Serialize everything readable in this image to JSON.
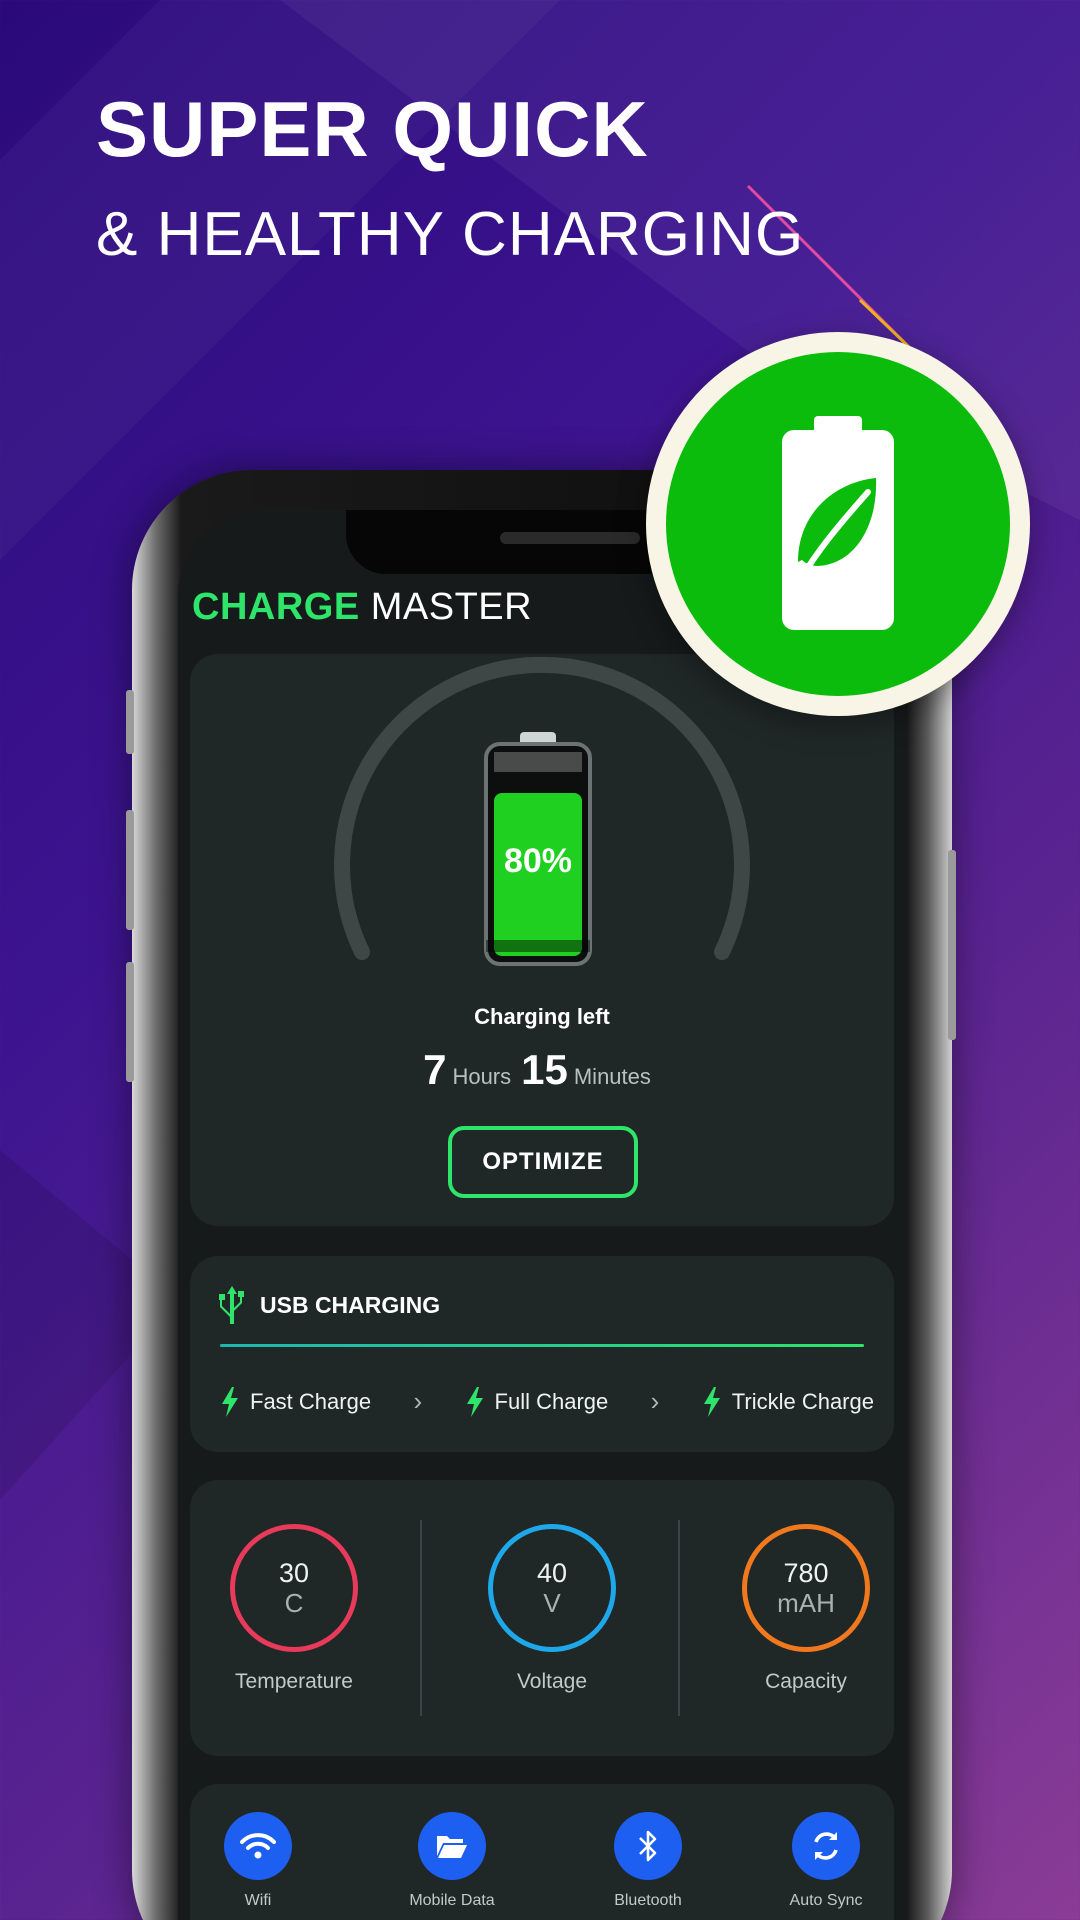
{
  "headline": {
    "line1": "SUPER QUICK",
    "line2": "& HEALTHY CHARGING"
  },
  "app": {
    "title_accent": "CHARGE",
    "title_rest": "MASTER"
  },
  "battery": {
    "percent_label": "80%",
    "level": 0.8,
    "charging_label": "Charging left",
    "hours": "7",
    "hours_unit": "Hours",
    "minutes": "15",
    "minutes_unit": "Minutes",
    "optimize_label": "OPTIMIZE"
  },
  "usb": {
    "label": "USB CHARGING",
    "modes": [
      {
        "label": "Fast Charge",
        "icon": "lightning-icon"
      },
      {
        "label": "Full Charge",
        "icon": "lightning-icon"
      },
      {
        "label": "Trickle Charge",
        "icon": "lightning-icon"
      }
    ]
  },
  "stats": [
    {
      "value": "30",
      "unit": "C",
      "name": "Temperature",
      "color": "#e83a5a"
    },
    {
      "value": "40",
      "unit": "V",
      "name": "Voltage",
      "color": "#1ea8ea"
    },
    {
      "value": "780",
      "unit": "mAH",
      "name": "Capacity",
      "color": "#f0781e"
    }
  ],
  "quick": [
    {
      "label": "Wifi",
      "icon": "wifi-icon"
    },
    {
      "label": "Mobile Data",
      "icon": "folder-icon"
    },
    {
      "label": "Bluetooth",
      "icon": "bluetooth-icon"
    },
    {
      "label": "Auto Sync",
      "icon": "sync-icon"
    }
  ],
  "colors": {
    "accent": "#2ee46a",
    "badge_green": "#0cbc0c",
    "quick_blue": "#1d5ff0",
    "background_purple": "#3d1490"
  }
}
